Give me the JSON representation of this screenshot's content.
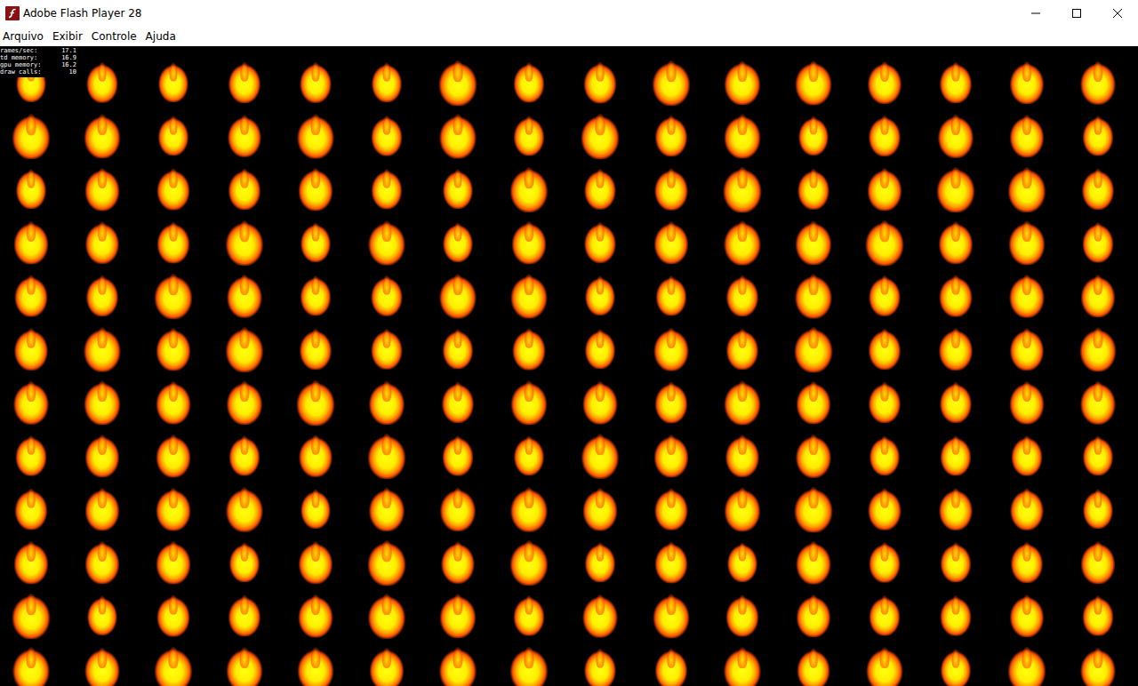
{
  "window": {
    "title": "Adobe Flash Player 28"
  },
  "menu": [
    {
      "label": "Arquivo"
    },
    {
      "label": "Exibir"
    },
    {
      "label": "Controle"
    },
    {
      "label": "Ajuda"
    }
  ],
  "stats": [
    {
      "label": "rames/sec:",
      "value": "17.1"
    },
    {
      "label": "td memory:",
      "value": "16.9"
    },
    {
      "label": "gpu memory:",
      "value": "16.2"
    },
    {
      "label": "draw calls:",
      "value": "10"
    }
  ]
}
